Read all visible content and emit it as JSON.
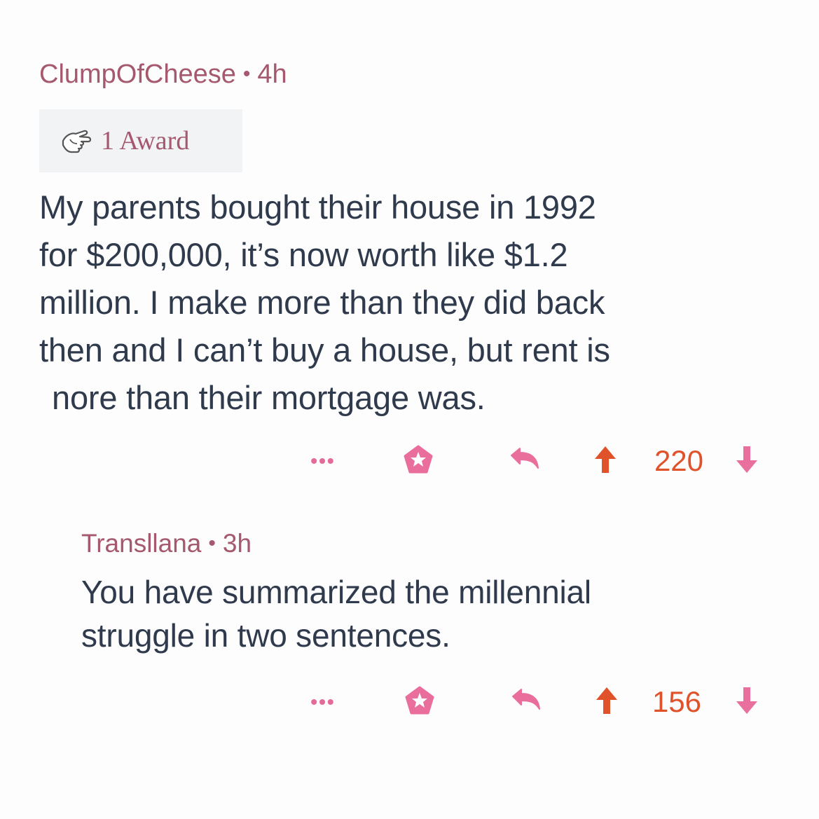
{
  "comments": [
    {
      "author": "ClumpOfCheese",
      "separator": "•",
      "age": "4h",
      "award_label": "1 Award",
      "body_lines": [
        "My parents bought their house in 1992",
        "for $200,000, it’s now worth like $1.2",
        "million. I make more than they did back",
        "then and I can’t buy a house, but rent is",
        "nore than their mortgage was."
      ],
      "more_label": "•••",
      "score": "220"
    },
    {
      "author": "Transllana",
      "separator": "•",
      "age": "3h",
      "body_lines": [
        "You have summarized the millennial",
        "struggle in two sentences."
      ],
      "more_label": "•••",
      "score": "156"
    }
  ],
  "icons": {
    "award": "pointing-hand-icon",
    "save": "star-pentagon-icon",
    "reply": "reply-arrow-icon",
    "upvote": "upvote-arrow-icon",
    "downvote": "downvote-arrow-icon",
    "more": "more-dots-icon"
  },
  "colors": {
    "meta": "#a5586e",
    "body_text": "#2f3a4c",
    "action_pink": "#e46a9a",
    "upvote": "#e0522a",
    "downvote": "#e96f9f",
    "award_bg": "#f1f3f4"
  }
}
